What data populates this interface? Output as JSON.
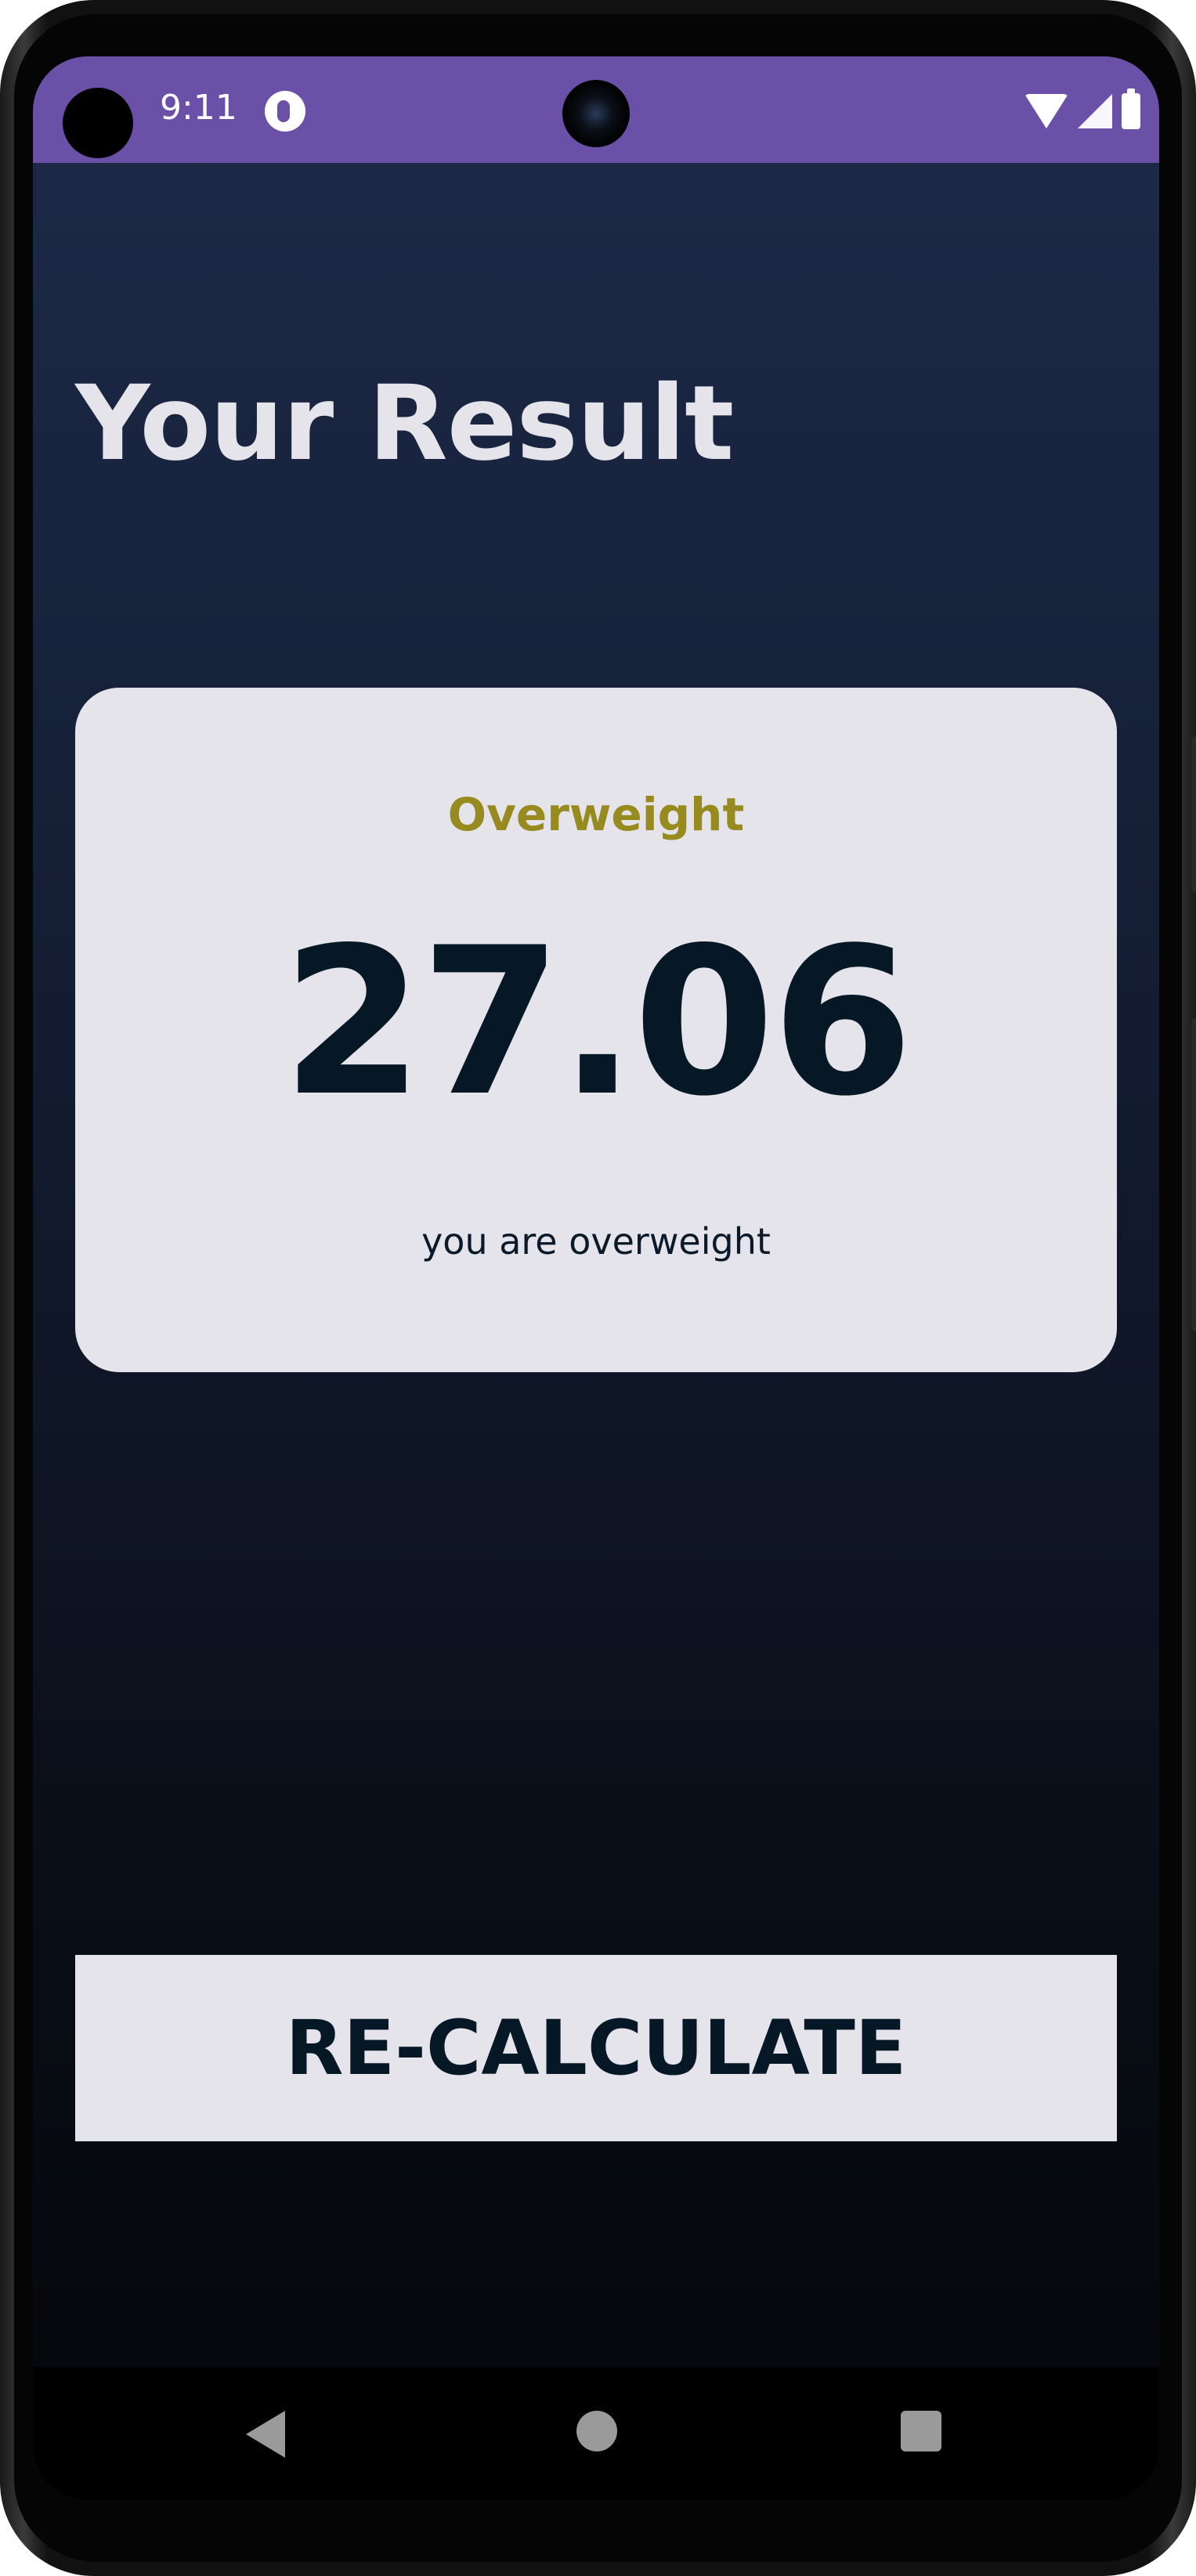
{
  "status_bar": {
    "time": "9:11",
    "background_color": "#6a50a7",
    "icons": [
      "app-notification-icon",
      "wifi-icon",
      "signal-icon",
      "battery-icon"
    ]
  },
  "page": {
    "title": "Your Result"
  },
  "result": {
    "status": "Overweight",
    "status_color": "#978a1f",
    "value": "27.06",
    "message": "you are overweight"
  },
  "actions": {
    "recalculate_label": "RE-CALCULATE"
  },
  "nav_bar": {
    "icons": [
      "back-icon",
      "home-icon",
      "recents-icon"
    ]
  },
  "colors": {
    "card_background": "#e4e4ea",
    "text_dark": "#061826",
    "background_top": "#1d2a48",
    "background_bottom": "#04060a"
  }
}
